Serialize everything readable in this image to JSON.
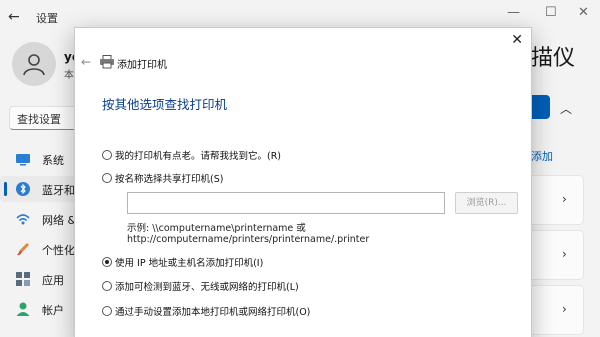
{
  "settings": {
    "title": "设置",
    "profile": {
      "name": "ye",
      "sub": "本"
    },
    "search_placeholder": "查找设置",
    "nav": [
      {
        "label": "系统",
        "icon": "monitor-icon"
      },
      {
        "label": "蓝牙和",
        "icon": "bluetooth-icon"
      },
      {
        "label": "网络 &",
        "icon": "wifi-icon"
      },
      {
        "label": "个性化",
        "icon": "brush-icon"
      },
      {
        "label": "应用",
        "icon": "apps-icon"
      },
      {
        "label": "帐户",
        "icon": "person-icon"
      }
    ],
    "right_title": "描仪",
    "right_link": "添加"
  },
  "dialog": {
    "title": "添加打印机",
    "heading": "按其他选项查找打印机",
    "options": [
      {
        "label": "我的打印机有点老。请帮我找到它。(R)",
        "checked": false
      },
      {
        "label": "按名称选择共享打印机(S)",
        "checked": false
      },
      {
        "label": "使用 IP 地址或主机名添加打印机(I)",
        "checked": true
      },
      {
        "label": "添加可检测到蓝牙、无线或网络的打印机(L)",
        "checked": false
      },
      {
        "label": "通过手动设置添加本地打印机或网络打印机(O)",
        "checked": false
      }
    ],
    "share_input_value": "",
    "browse_label": "浏览(R)...",
    "example_line1": "示例: \\\\computername\\printername 或",
    "example_line2": "http://computername/printers/printername/.printer"
  },
  "colors": {
    "accent": "#005fb8",
    "heading": "#0a3d91"
  }
}
